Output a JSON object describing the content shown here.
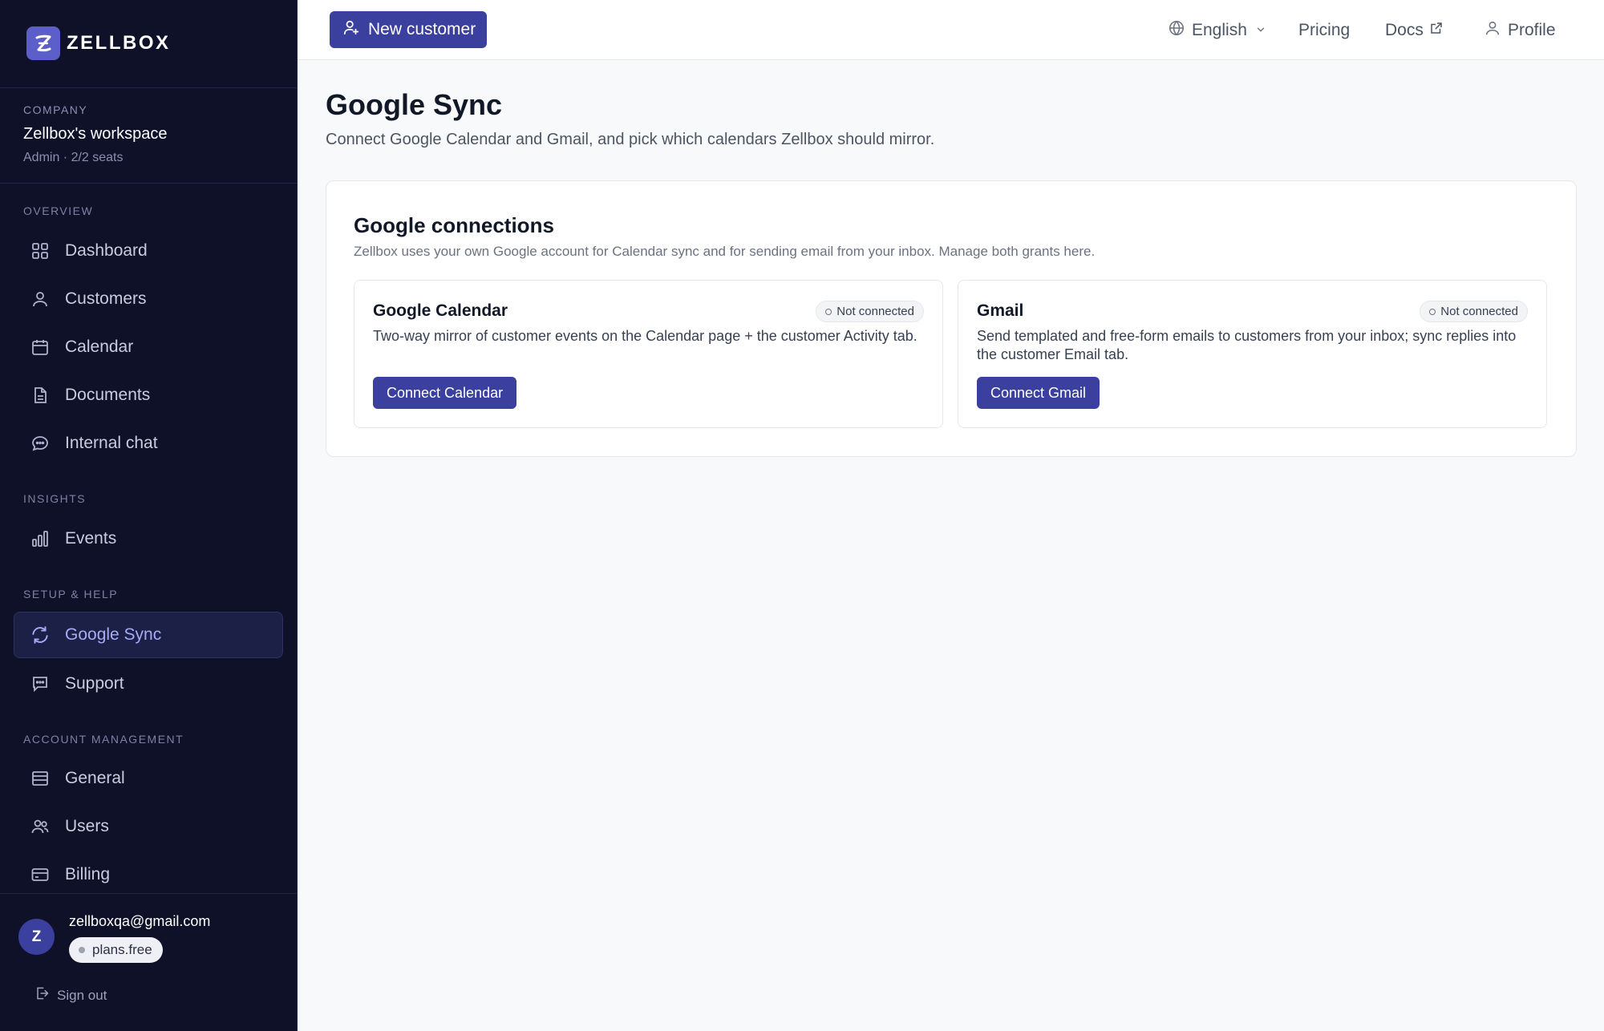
{
  "app": {
    "brand": "ZELLBOX"
  },
  "sidebar": {
    "company_caption": "COMPANY",
    "company_name": "Zellbox's workspace",
    "company_meta": "Admin · 2/2 seats",
    "sections": {
      "overview": "OVERVIEW",
      "insights": "INSIGHTS",
      "setup_help": "SETUP & HELP",
      "account_management": "ACCOUNT MANAGEMENT"
    },
    "items": [
      {
        "label": "Dashboard",
        "icon": "grid-icon"
      },
      {
        "label": "Customers",
        "icon": "user-icon"
      },
      {
        "label": "Calendar",
        "icon": "calendar-icon"
      },
      {
        "label": "Documents",
        "icon": "document-icon"
      },
      {
        "label": "Internal chat",
        "icon": "chat-icon"
      },
      {
        "label": "Events",
        "icon": "bar-chart-icon"
      },
      {
        "label": "Google Sync",
        "icon": "refresh-icon",
        "active": true
      },
      {
        "label": "Support",
        "icon": "message-icon"
      },
      {
        "label": "General",
        "icon": "list-icon"
      },
      {
        "label": "Users",
        "icon": "users-icon"
      },
      {
        "label": "Billing",
        "icon": "credit-card-icon"
      }
    ],
    "user": {
      "avatar_initial": "Z",
      "email": "zellboxqa@gmail.com",
      "plan": "plans.free",
      "sign_out": "Sign out"
    }
  },
  "topbar": {
    "new_customer": "New customer",
    "language": "English",
    "pricing": "Pricing",
    "docs": "Docs",
    "profile": "Profile"
  },
  "page": {
    "title": "Google Sync",
    "subtitle": "Connect Google Calendar and Gmail, and pick which calendars Zellbox should mirror."
  },
  "connections_card": {
    "title": "Google connections",
    "description": "Zellbox uses your own Google account for Calendar sync and for sending email from your inbox. Manage both grants here.",
    "calendar": {
      "title": "Google Calendar",
      "status": "Not connected",
      "description": "Two-way mirror of customer events on the Calendar page + the customer Activity tab.",
      "button": "Connect Calendar"
    },
    "gmail": {
      "title": "Gmail",
      "status": "Not connected",
      "description": "Send templated and free-form emails to customers from your inbox; sync replies into the customer Email tab.",
      "button": "Connect Gmail"
    }
  },
  "colors": {
    "sidebar_bg": "#0f1129",
    "accent": "#3b3f9e",
    "active_text": "#a5acf5"
  }
}
